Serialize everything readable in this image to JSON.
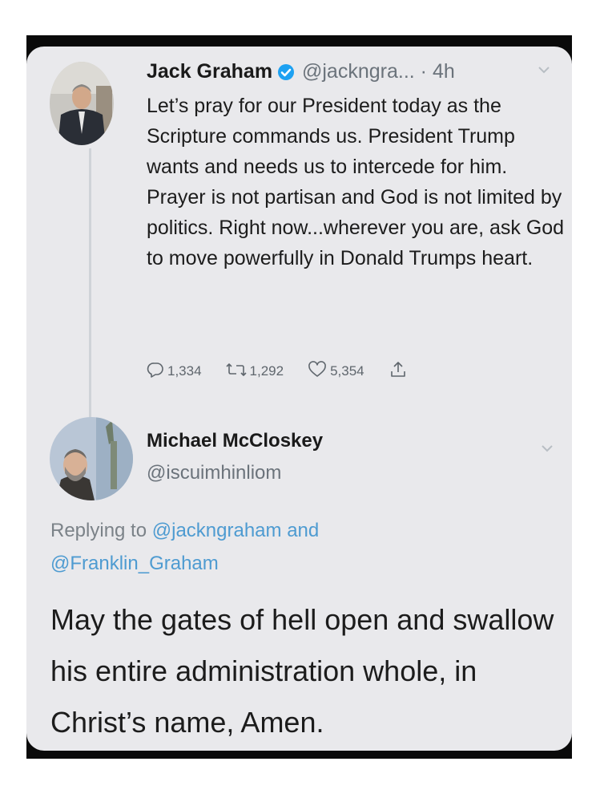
{
  "tweet": {
    "author": "Jack Graham",
    "handle": "@jackngra...",
    "time": "· 4h",
    "body": "Let’s pray for our President today as the Scripture commands us. President Trump wants and needs us to intercede for him. Prayer is not partisan and God is not limited by politics. Right now...wherever you are, ask God to move powerfully in Donald Trumps heart.",
    "replies": "1,334",
    "retweets": "1,292",
    "likes": "5,354"
  },
  "reply": {
    "author": "Michael McCloskey",
    "handle": "@iscuimhinliom",
    "replying_prefix": "Replying to",
    "replying_to_1": "@jackngraham",
    "replying_and": "and",
    "replying_to_2": "@Franklin_Graham",
    "body": "May the gates of hell open and swallow his entire administration whole, in Christ’s name, Amen."
  },
  "icons": {
    "verified": "verified-badge-icon",
    "caret": "chevron-down-icon",
    "reply": "reply-icon",
    "retweet": "retweet-icon",
    "like": "heart-icon",
    "share": "share-icon"
  },
  "colors": {
    "card_bg": "#e9e9ec",
    "verified_blue": "#1da1f2",
    "link_blue": "#4e9bd1",
    "muted_text": "#6b737b"
  }
}
